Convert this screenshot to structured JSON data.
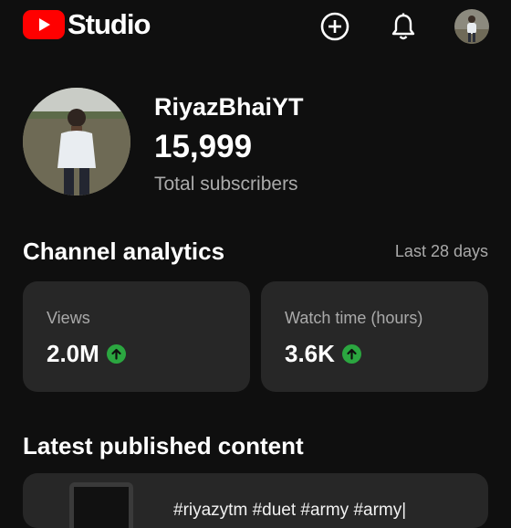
{
  "header": {
    "app_name": "Studio",
    "brand_color": "#ff0000",
    "create_icon": "add-circle-icon",
    "notifications_icon": "bell-icon"
  },
  "channel": {
    "name": "RiyazBhaiYT",
    "subscribers": "15,999",
    "subscribers_label": "Total subscribers"
  },
  "analytics": {
    "title": "Channel analytics",
    "period": "Last 28 days",
    "trend_color": "#2ba640",
    "cards": [
      {
        "label": "Views",
        "value": "2.0M",
        "trend_icon": "arrow-up-icon"
      },
      {
        "label": "Watch time (hours)",
        "value": "3.6K",
        "trend_icon": "arrow-up-icon"
      }
    ]
  },
  "latest": {
    "title": "Latest published content",
    "item_title": "#riyazytm #duet #army #army|"
  }
}
